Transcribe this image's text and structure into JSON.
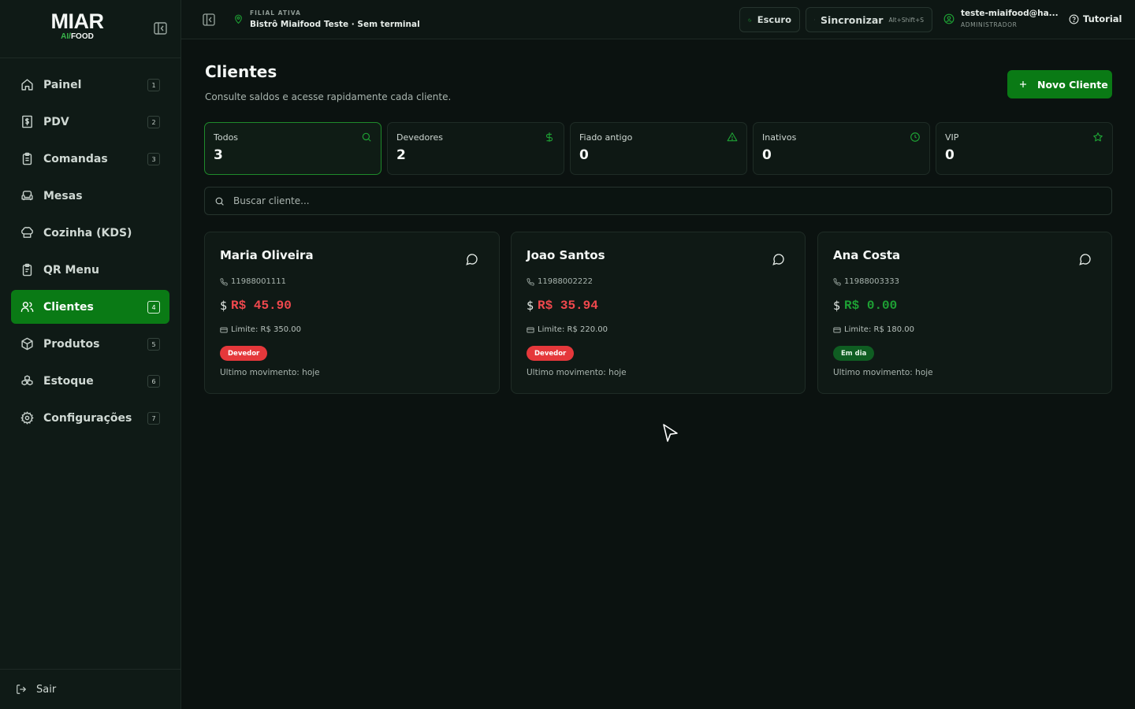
{
  "brand": {
    "name": "MIAR",
    "sub_ai": "AI",
    "sub_slash": "/",
    "sub_food": "FOOD"
  },
  "sidebar": {
    "items": [
      {
        "label": "Painel",
        "badge": "1",
        "icon": "home-icon"
      },
      {
        "label": "PDV",
        "badge": "2",
        "icon": "receipt-dollar-icon"
      },
      {
        "label": "Comandas",
        "badge": "3",
        "icon": "clipboard-icon"
      },
      {
        "label": "Mesas",
        "badge": "",
        "icon": "armchair-icon"
      },
      {
        "label": "Cozinha (KDS)",
        "badge": "",
        "icon": "chef-hat-icon"
      },
      {
        "label": "QR Menu",
        "badge": "",
        "icon": "clipboard-list-icon"
      },
      {
        "label": "Clientes",
        "badge": "4",
        "icon": "users-icon",
        "active": true
      },
      {
        "label": "Produtos",
        "badge": "5",
        "icon": "package-icon"
      },
      {
        "label": "Estoque",
        "badge": "6",
        "icon": "boxes-icon"
      },
      {
        "label": "Configurações",
        "badge": "7",
        "icon": "gear-icon"
      }
    ],
    "logout_label": "Sair"
  },
  "topbar": {
    "branch_caption": "FILIAL ATIVA",
    "branch_name": "Bistrô Miaifood Teste · Sem terminal",
    "theme_label": "Escuro",
    "sync_label": "Sincronizar",
    "sync_shortcut": "Alt+Shift+S",
    "user_email": "teste-miaifood@ha...",
    "user_role": "ADMINISTRADOR",
    "tutorial_label": "Tutorial"
  },
  "page": {
    "title": "Clientes",
    "subtitle": "Consulte saldos e acesse rapidamente cada cliente.",
    "new_button_label": "Novo Cliente"
  },
  "stats": [
    {
      "label": "Todos",
      "value": "3",
      "icon": "search-icon",
      "active": true
    },
    {
      "label": "Devedores",
      "value": "2",
      "icon": "dollar-icon"
    },
    {
      "label": "Fiado antigo",
      "value": "0",
      "icon": "warning-icon"
    },
    {
      "label": "Inativos",
      "value": "0",
      "icon": "clock-icon"
    },
    {
      "label": "VIP",
      "value": "0",
      "icon": "star-icon"
    }
  ],
  "search": {
    "placeholder": "Buscar cliente..."
  },
  "clients": [
    {
      "name": "Maria Oliveira",
      "phone": "11988001111",
      "currency_symbol": "$",
      "balance": "R$ 45.90",
      "limit": "Limite: R$ 350.00",
      "status": "Devedor",
      "last_movement": "Ultimo movimento: hoje"
    },
    {
      "name": "Joao Santos",
      "phone": "11988002222",
      "currency_symbol": "$",
      "balance": "R$ 35.94",
      "limit": "Limite: R$ 220.00",
      "status": "Devedor",
      "last_movement": "Ultimo movimento: hoje"
    },
    {
      "name": "Ana Costa",
      "phone": "11988003333",
      "currency_symbol": "$",
      "balance": "R$ 0.00",
      "limit": "Limite: R$ 180.00",
      "status": "Em dia",
      "last_movement": "Ultimo movimento: hoje"
    }
  ],
  "colors": {
    "accent": "#0a7a15",
    "debt": "#f0484d",
    "ok": "#1ea034",
    "background": "#0b1210"
  }
}
